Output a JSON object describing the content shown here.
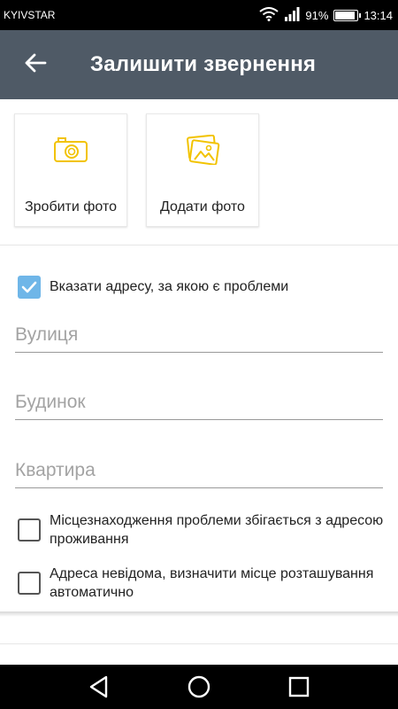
{
  "status_bar": {
    "carrier": "KYIVSTAR",
    "battery_percent": "91%",
    "battery_level": 0.91,
    "time": "13:14",
    "icons": [
      "wifi-icon",
      "signal-icon",
      "battery-icon"
    ]
  },
  "app_bar": {
    "title": "Залишити звернення",
    "back_icon": "arrow-back-icon",
    "background": "#4f5a66"
  },
  "photo_actions": [
    {
      "label": "Зробити фото",
      "icon": "camera-icon"
    },
    {
      "label": "Додати фото",
      "icon": "photo-gallery-icon"
    }
  ],
  "accent_color": "#f2c300",
  "specify_address": {
    "label": "Вказати адресу, за якою є проблеми",
    "checked": true,
    "check_color": "#6fb6e8"
  },
  "fields": {
    "street_placeholder": "Вулиця",
    "building_placeholder": "Будинок",
    "apartment_placeholder": "Квартира"
  },
  "options": [
    {
      "label": "Місцезнаходження проблеми збігається з адресою проживання",
      "checked": false
    },
    {
      "label": "Адреса невідома, визначити місце розташування автоматично",
      "checked": false
    }
  ],
  "nav_bar": {
    "icons": [
      "back-triangle-icon",
      "home-circle-icon",
      "recents-square-icon"
    ]
  }
}
